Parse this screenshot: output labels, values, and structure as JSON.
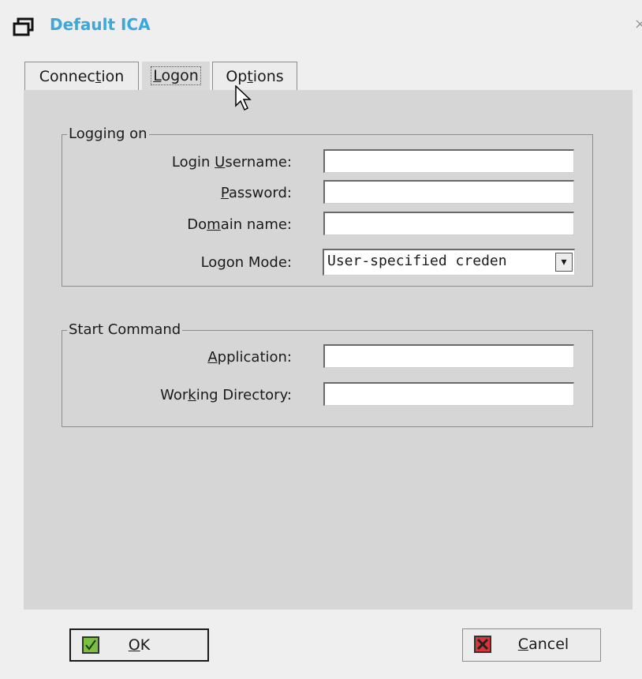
{
  "window": {
    "title": "Default ICA",
    "close_glyph": "×"
  },
  "tabs": [
    {
      "name": "connection",
      "pre": "Connec",
      "ul": "t",
      "post": "ion",
      "active": false
    },
    {
      "name": "logon",
      "pre": "",
      "ul": "L",
      "post": "ogon",
      "active": true
    },
    {
      "name": "options",
      "pre": "Op",
      "ul": "t",
      "post": "ions",
      "active": false
    }
  ],
  "logging_on": {
    "group_label": "Logging on",
    "username": {
      "pre": "Login ",
      "ul": "U",
      "post": "sername:",
      "value": ""
    },
    "password": {
      "pre": "",
      "ul": "P",
      "post": "assword:",
      "value": ""
    },
    "domain": {
      "pre": "Do",
      "ul": "m",
      "post": "ain name:",
      "value": ""
    },
    "logon_mode": {
      "pre": "Lo",
      "ul": "g",
      "post": "on Mode:",
      "value": "User-specified creden",
      "arrow": "▾"
    }
  },
  "start_command": {
    "group_label": "Start Command",
    "application": {
      "pre": "",
      "ul": "A",
      "post": "pplication:",
      "value": ""
    },
    "working_directory": {
      "pre": "Wor",
      "ul": "k",
      "post": "ing Directory:",
      "value": ""
    }
  },
  "buttons": {
    "ok": {
      "pre": "",
      "ul": "O",
      "post": "K"
    },
    "cancel": {
      "pre": "",
      "ul": "C",
      "post": "ancel"
    }
  },
  "colors": {
    "title": "#3aa8dd",
    "panel": "#d6d6d6",
    "ok_icon": "#7bc043",
    "cancel_icon": "#d9343a"
  },
  "icons": {
    "window": "window-icon",
    "ok": "check-icon",
    "cancel": "x-icon",
    "cursor": "mouse-pointer-icon"
  }
}
